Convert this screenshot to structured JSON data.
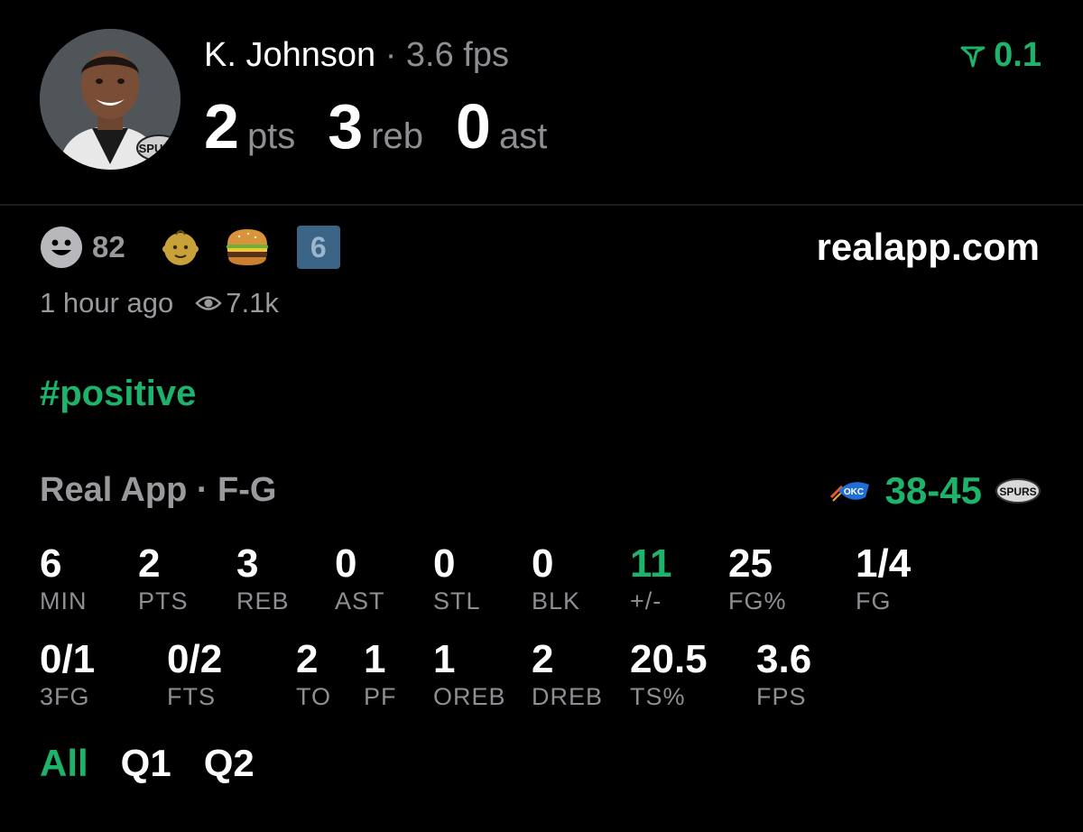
{
  "colors": {
    "accent": "#1db36b",
    "muted": "#8e8e93",
    "background": "#000000"
  },
  "header": {
    "player_name": "K. Johnson",
    "fps_text": " · 3.6 fps",
    "pts_value": "2",
    "pts_unit": "pts",
    "reb_value": "3",
    "reb_unit": "reb",
    "ast_value": "0",
    "ast_unit": "ast",
    "vote_icon": "upvote-arrow-icon",
    "vote_value": "0.1"
  },
  "reactions": {
    "smile_icon": "smile-icon",
    "smile_count": "82",
    "baby_icon": "baby-face-icon",
    "burger_icon": "burger-icon",
    "badge_value": "6"
  },
  "source": "realapp.com",
  "meta": {
    "time": "1 hour ago",
    "views": "7.1k",
    "views_icon": "eye-icon"
  },
  "hashtag": "#positive",
  "game": {
    "title": "Real App · F-G",
    "away_logo": "okc-logo-icon",
    "home_logo": "spurs-logo-icon",
    "score": "38-45"
  },
  "stats_row1": [
    {
      "value": "6",
      "label": "MIN"
    },
    {
      "value": "2",
      "label": "PTS"
    },
    {
      "value": "3",
      "label": "REB"
    },
    {
      "value": "0",
      "label": "AST"
    },
    {
      "value": "0",
      "label": "STL"
    },
    {
      "value": "0",
      "label": "BLK"
    },
    {
      "value": "11",
      "label": "+/-"
    },
    {
      "value": "25",
      "label": "FG%"
    },
    {
      "value": "1/4",
      "label": "FG"
    }
  ],
  "stats_row2": [
    {
      "value": "0/1",
      "label": "3FG"
    },
    {
      "value": "0/2",
      "label": "FTS"
    },
    {
      "value": "2",
      "label": "TO"
    },
    {
      "value": "1",
      "label": "PF"
    },
    {
      "value": "1",
      "label": "OREB"
    },
    {
      "value": "2",
      "label": "DREB"
    },
    {
      "value": "20.5",
      "label": "TS%"
    },
    {
      "value": "3.6",
      "label": "FPS"
    }
  ],
  "tabs": [
    {
      "label": "All",
      "active": true
    },
    {
      "label": "Q1",
      "active": false
    },
    {
      "label": "Q2",
      "active": false
    }
  ]
}
